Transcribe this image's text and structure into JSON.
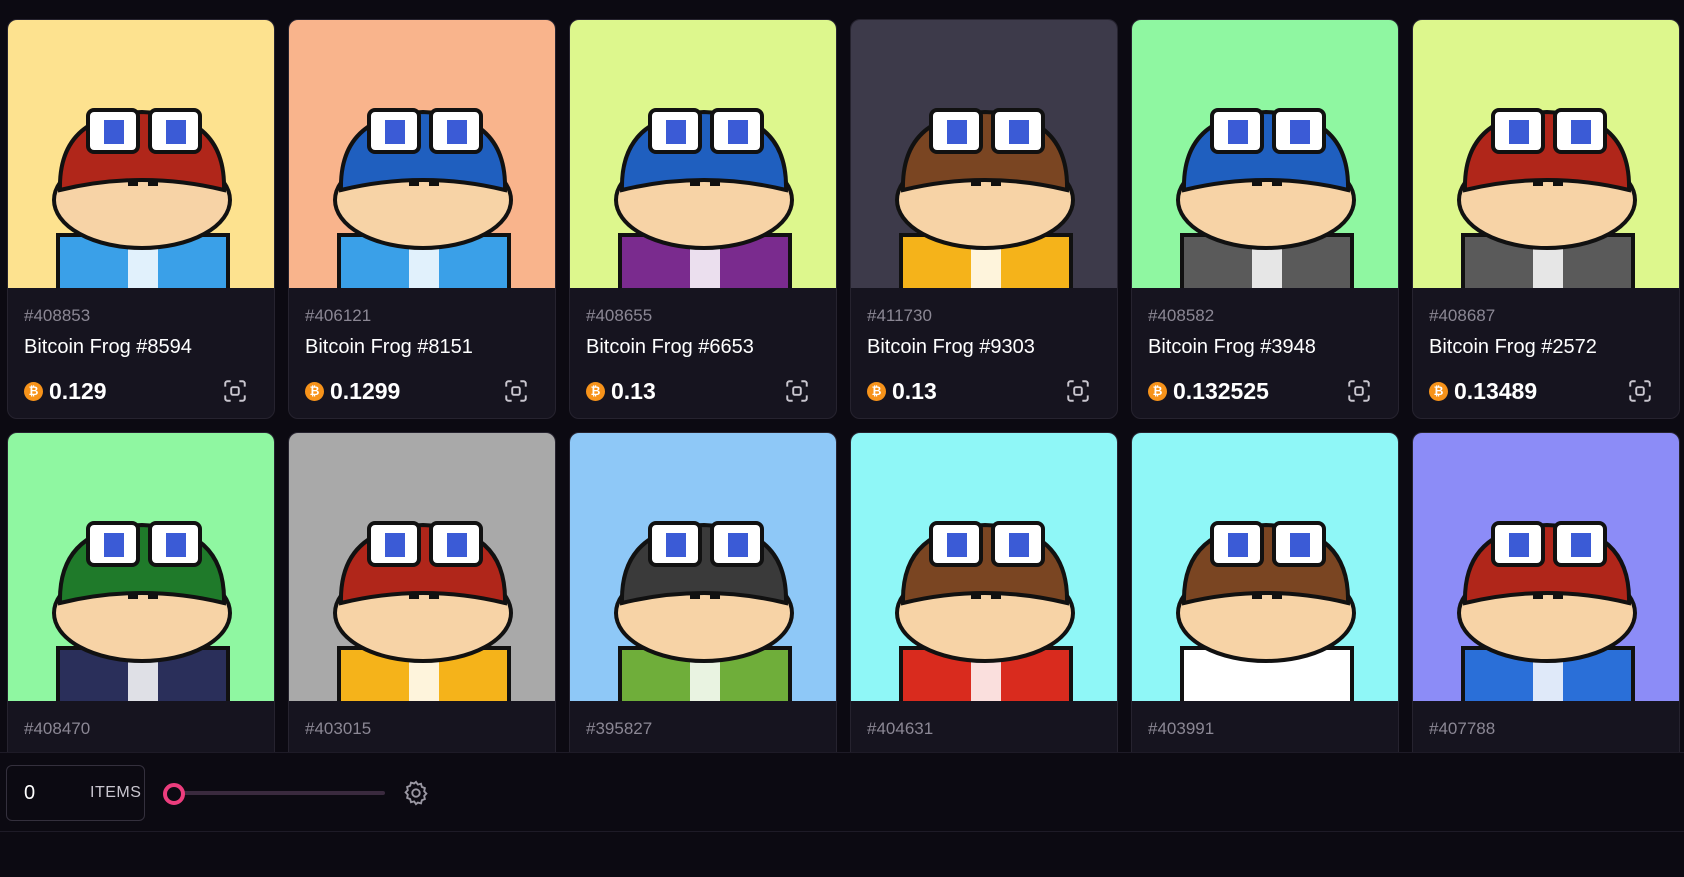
{
  "colors": {
    "accent": "#ec3d7d",
    "bitcoin": "#f7931a",
    "card_bg": "#16141f",
    "page_bg": "#0c0a12"
  },
  "currency_icon": "bitcoin-icon",
  "cards": [
    {
      "inscription": "#408853",
      "name": "Bitcoin Frog #8594",
      "price": "0.129",
      "bg": "#fde28f",
      "skin": "#b0261a",
      "shirt": "#3aa0e8"
    },
    {
      "inscription": "#406121",
      "name": "Bitcoin Frog #8151",
      "price": "0.1299",
      "bg": "#f9b48c",
      "skin": "#1f5fbf",
      "shirt": "#3aa0e8"
    },
    {
      "inscription": "#408655",
      "name": "Bitcoin Frog #6653",
      "price": "0.13",
      "bg": "#ddf78d",
      "skin": "#1f5fbf",
      "shirt": "#7a2b8e"
    },
    {
      "inscription": "#411730",
      "name": "Bitcoin Frog #9303",
      "price": "0.13",
      "bg": "#3d3a4a",
      "skin": "#7a4522",
      "shirt": "#f5b31a"
    },
    {
      "inscription": "#408582",
      "name": "Bitcoin Frog #3948",
      "price": "0.132525",
      "bg": "#8ff7a1",
      "skin": "#1f5fbf",
      "shirt": "#5a5a5a"
    },
    {
      "inscription": "#408687",
      "name": "Bitcoin Frog #2572",
      "price": "0.13489",
      "bg": "#ddf78d",
      "skin": "#b0261a",
      "shirt": "#5a5a5a"
    },
    {
      "inscription": "#408470",
      "name": "",
      "price": "",
      "bg": "#8ff7a1",
      "skin": "#1f7a2a",
      "shirt": "#2a2f5a"
    },
    {
      "inscription": "#403015",
      "name": "",
      "price": "",
      "bg": "#a9a9a9",
      "skin": "#b0261a",
      "shirt": "#f5b31a"
    },
    {
      "inscription": "#395827",
      "name": "",
      "price": "",
      "bg": "#8ec8f7",
      "skin": "#3a3a3a",
      "shirt": "#6fae3a"
    },
    {
      "inscription": "#404631",
      "name": "",
      "price": "",
      "bg": "#8ff7f7",
      "skin": "#7a4522",
      "shirt": "#d92b1e"
    },
    {
      "inscription": "#403991",
      "name": "",
      "price": "",
      "bg": "#8ff7f7",
      "skin": "#7a4522",
      "shirt": "#ffffff"
    },
    {
      "inscription": "#407788",
      "name": "",
      "price": "",
      "bg": "#8c8cf7",
      "skin": "#b0261a",
      "shirt": "#2a6fd8"
    }
  ],
  "footer": {
    "items_count": "0",
    "items_label": "ITEMS",
    "slider_value": 0
  }
}
